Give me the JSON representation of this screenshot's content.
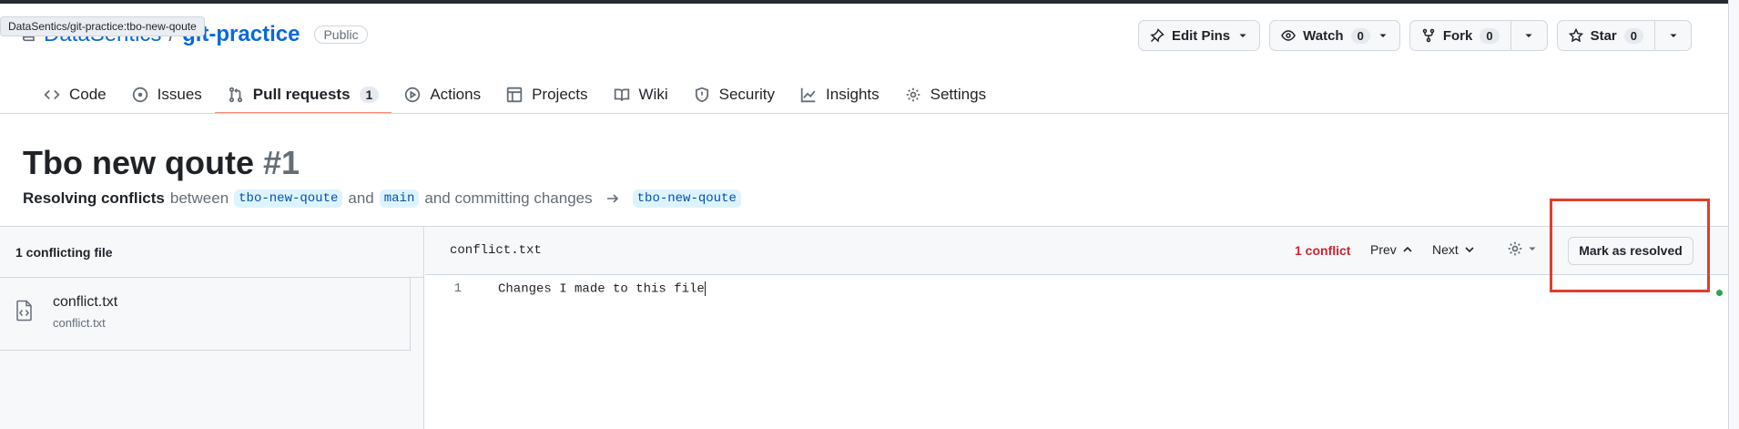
{
  "tooltip": "DataSentics/git-practice:tbo-new-qoute",
  "repo": {
    "owner": "DataSentics",
    "separator": "/",
    "name": "git-practice",
    "visibility": "Public"
  },
  "header_actions": {
    "edit_pins": "Edit Pins",
    "watch": "Watch",
    "watch_count": "0",
    "fork": "Fork",
    "fork_count": "0",
    "star": "Star",
    "star_count": "0"
  },
  "tabs": [
    {
      "label": "Code",
      "icon": "code-icon"
    },
    {
      "label": "Issues",
      "icon": "issue-icon"
    },
    {
      "label": "Pull requests",
      "icon": "pull-request-icon",
      "count": "1",
      "active": true
    },
    {
      "label": "Actions",
      "icon": "play-icon"
    },
    {
      "label": "Projects",
      "icon": "table-icon"
    },
    {
      "label": "Wiki",
      "icon": "book-icon"
    },
    {
      "label": "Security",
      "icon": "shield-icon"
    },
    {
      "label": "Insights",
      "icon": "graph-icon"
    },
    {
      "label": "Settings",
      "icon": "gear-icon"
    }
  ],
  "pr": {
    "title": "Tbo new qoute",
    "number": "#1",
    "sub_prefix": "Resolving conflicts",
    "sub_between": "between",
    "head_branch": "tbo-new-qoute",
    "sub_and": "and",
    "base_branch": "main",
    "sub_committing": "and committing changes",
    "target_branch": "tbo-new-qoute"
  },
  "file_panel": {
    "header": "1 conflicting file",
    "files": [
      {
        "name": "conflict.txt",
        "path": "conflict.txt"
      }
    ]
  },
  "editor": {
    "filename": "conflict.txt",
    "conflict_count": "1 conflict",
    "prev_label": "Prev",
    "next_label": "Next",
    "mark_resolved": "Mark as resolved",
    "lines": [
      {
        "number": "1",
        "text": "Changes I made to this file"
      }
    ]
  },
  "colors": {
    "link": "#0969da",
    "active_tab_underline": "#fd8c73",
    "conflict_red": "#cf222e",
    "highlight_box": "#e03e2d"
  }
}
